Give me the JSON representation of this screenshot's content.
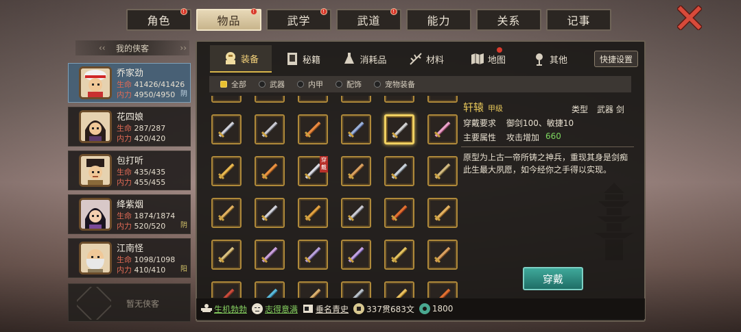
{
  "top_tabs": [
    {
      "label": "角色",
      "badge": "!"
    },
    {
      "label": "物品",
      "badge": "!"
    },
    {
      "label": "武学",
      "badge": "!"
    },
    {
      "label": "武道",
      "badge": "!"
    },
    {
      "label": "能力",
      "badge": ""
    },
    {
      "label": "关系",
      "badge": ""
    },
    {
      "label": "记事",
      "badge": ""
    }
  ],
  "left_panel": {
    "header": "我的侠客",
    "characters": [
      {
        "name": "乔家劲",
        "hp_label": "生命",
        "hp": "41426/41426",
        "mp_label": "内力",
        "mp": "4950/4950",
        "tag": "阴"
      },
      {
        "name": "花四娘",
        "hp_label": "生命",
        "hp": "287/287",
        "mp_label": "内力",
        "mp": "420/420",
        "tag": ""
      },
      {
        "name": "包打听",
        "hp_label": "生命",
        "hp": "435/435",
        "mp_label": "内力",
        "mp": "455/455",
        "tag": ""
      },
      {
        "name": "绛紫烟",
        "hp_label": "生命",
        "hp": "1874/1874",
        "mp_label": "内力",
        "mp": "520/520",
        "tag": "阴"
      },
      {
        "name": "江南怪",
        "hp_label": "生命",
        "hp": "1098/1098",
        "mp_label": "内力",
        "mp": "410/410",
        "tag": "阳"
      }
    ],
    "empty_slot": "暂无侠客"
  },
  "category_tabs": [
    {
      "label": "装备",
      "icon": "equipment-icon"
    },
    {
      "label": "秘籍",
      "icon": "book-icon"
    },
    {
      "label": "消耗品",
      "icon": "potion-icon"
    },
    {
      "label": "材料",
      "icon": "herb-icon"
    },
    {
      "label": "地图",
      "icon": "map-icon"
    },
    {
      "label": "其他",
      "icon": "misc-icon"
    }
  ],
  "quick_settings": "快捷设置",
  "filters": [
    "全部",
    "武器",
    "内甲",
    "配饰",
    "宠物装备"
  ],
  "worn_badge": "穿戴",
  "detail": {
    "name": "轩辕",
    "grade": "甲级",
    "type_label": "类型",
    "type_value": "武器 剑",
    "req_label": "穿戴要求",
    "req_value": "御剑100、敏捷10",
    "attr_label": "主要属性",
    "attr_value": "攻击增加",
    "attr_number": "660",
    "description": "原型为上古一帝所铸之神兵，重现其身是剑痴此生最大夙愿，如今经你之手得以实现。",
    "wear_button": "穿戴"
  },
  "status_bar": {
    "vitality": "生机勃勃",
    "mood": "志得意满",
    "fame": "垂名青史",
    "money": "337贯683文",
    "jade": "1800"
  },
  "colors": {
    "accent_gold": "#e8c75a",
    "highlight_green": "#7ed860",
    "badge_red": "#d83a2c",
    "button_teal": "#2f8a80"
  }
}
